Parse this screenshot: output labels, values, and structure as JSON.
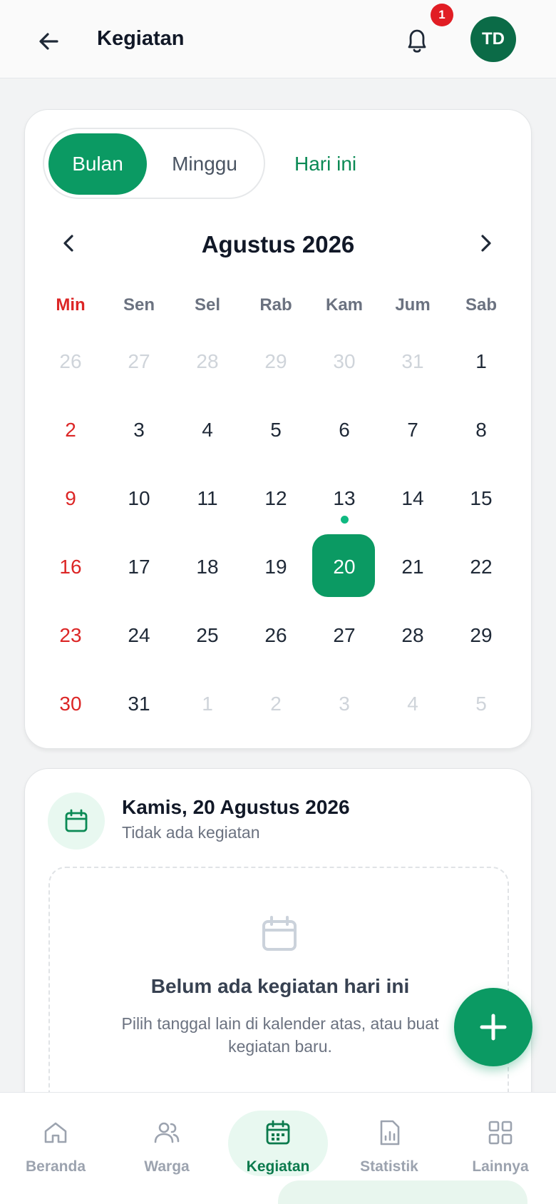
{
  "header": {
    "title": "Kegiatan",
    "notification_count": "1",
    "avatar_initials": "TD"
  },
  "calendar": {
    "view_toggle": {
      "month_label": "Bulan",
      "week_label": "Minggu",
      "active": "month"
    },
    "today_label": "Hari ini",
    "month_title": "Agustus 2026",
    "weekdays": [
      "Min",
      "Sen",
      "Sel",
      "Rab",
      "Kam",
      "Jum",
      "Sab"
    ],
    "weeks": [
      [
        "26",
        "27",
        "28",
        "29",
        "30",
        "31",
        "1"
      ],
      [
        "2",
        "3",
        "4",
        "5",
        "6",
        "7",
        "8"
      ],
      [
        "9",
        "10",
        "11",
        "12",
        "13",
        "14",
        "15"
      ],
      [
        "16",
        "17",
        "18",
        "19",
        "20",
        "21",
        "22"
      ],
      [
        "23",
        "24",
        "25",
        "26",
        "27",
        "28",
        "29"
      ],
      [
        "30",
        "31",
        "1",
        "2",
        "3",
        "4",
        "5"
      ]
    ],
    "selected_day": "20",
    "event_days": [
      "13"
    ]
  },
  "detail": {
    "date": "Kamis, 20 Agustus 2026",
    "subtitle": "Tidak ada kegiatan",
    "empty_title": "Belum ada kegiatan hari ini",
    "empty_desc": "Pilih tanggal lain di kalender atas, atau buat kegiatan baru."
  },
  "bottom_nav": {
    "items": [
      {
        "label": "Beranda",
        "icon": "home-icon"
      },
      {
        "label": "Warga",
        "icon": "users-icon"
      },
      {
        "label": "Kegiatan",
        "icon": "calendar-icon",
        "active": true
      },
      {
        "label": "Statistik",
        "icon": "chart-icon"
      },
      {
        "label": "Lainnya",
        "icon": "grid-icon"
      }
    ]
  },
  "colors": {
    "primary": "#0b9a63",
    "sunday": "#dc2626",
    "badge": "#e11d24",
    "avatar": "#0b6b47"
  }
}
